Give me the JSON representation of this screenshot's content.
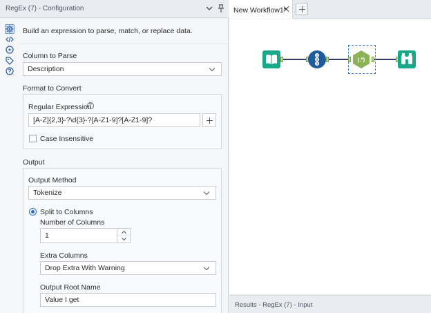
{
  "config_panel": {
    "title": "RegEx (7) - Configuration",
    "description": "Build an expression to parse, match, or replace data.",
    "column_to_parse": {
      "label": "Column to Parse",
      "value": "Description"
    },
    "format_to_convert": {
      "label": "Format to Convert",
      "regular_expression_label": "Regular Expression",
      "regular_expression_value": "[A-Z]{2,3}-?\\d{3}-?[A-Z1-9]?[A-Z1-9]?",
      "case_insensitive_label": "Case Insensitive",
      "case_insensitive_checked": false
    },
    "output": {
      "label": "Output",
      "output_method_label": "Output Method",
      "output_method_value": "Tokenize",
      "split_to_columns_label": "Split to Columns",
      "split_to_columns_selected": true,
      "number_of_columns_label": "Number of Columns",
      "number_of_columns_value": "1",
      "extra_columns_label": "Extra Columns",
      "extra_columns_value": "Drop Extra With Warning",
      "output_root_name_label": "Output Root Name",
      "output_root_name_value": "Value I get"
    },
    "rail_icons": [
      "gear-icon",
      "code-icon",
      "annotation-icon",
      "tag-icon",
      "help-icon"
    ]
  },
  "workflow": {
    "tab_label": "New Workflow1*",
    "tools": [
      "input-data-tool-icon",
      "record-id-tool-icon",
      "regex-tool-icon",
      "browse-tool-icon"
    ],
    "regex_glyph": "(.*)",
    "record_id_glyph": "123",
    "colors": {
      "input": "#1aa88b",
      "record_id": "#1e5c9b",
      "regex": "#8cb456",
      "browse": "#1aa88b",
      "connector": "#333a63",
      "selection": "#2e7cd6"
    }
  },
  "results": {
    "label": "Results - RegEx (7) - Input"
  }
}
